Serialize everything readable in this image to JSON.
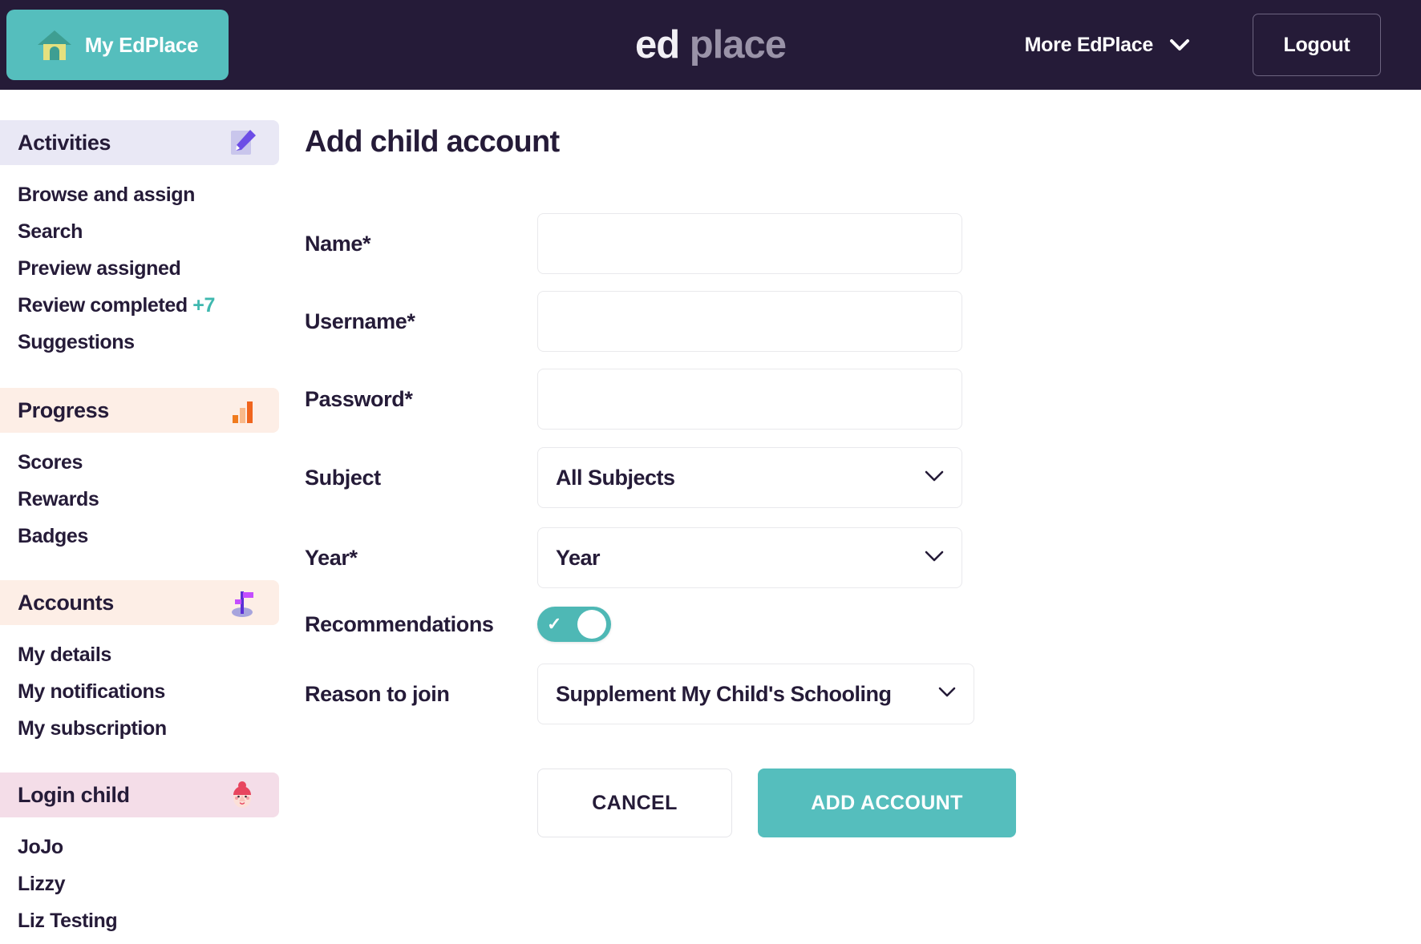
{
  "header": {
    "home_button_label": "My EdPlace",
    "home_icon": "house-icon",
    "logo_part1": "ed",
    "logo_part2": "place",
    "more_label": "More EdPlace",
    "more_chevron_icon": "chevron-down-icon",
    "logout_label": "Logout"
  },
  "sidebar": {
    "sections": [
      {
        "title": "Activities",
        "icon": "pencil-note-icon",
        "bg": "#e9e8f5",
        "items": [
          {
            "label": "Browse and assign",
            "badge": ""
          },
          {
            "label": "Search",
            "badge": ""
          },
          {
            "label": "Preview assigned",
            "badge": ""
          },
          {
            "label": "Review completed",
            "badge": "+7"
          },
          {
            "label": "Suggestions",
            "badge": ""
          }
        ]
      },
      {
        "title": "Progress",
        "icon": "bar-chart-icon",
        "bg": "#fdeee6",
        "items": [
          {
            "label": "Scores",
            "badge": ""
          },
          {
            "label": "Rewards",
            "badge": ""
          },
          {
            "label": "Badges",
            "badge": ""
          }
        ]
      },
      {
        "title": "Accounts",
        "icon": "signpost-icon",
        "bg": "#fdeee6",
        "items": [
          {
            "label": "My details",
            "badge": ""
          },
          {
            "label": "My notifications",
            "badge": ""
          },
          {
            "label": "My subscription",
            "badge": ""
          }
        ]
      },
      {
        "title": "Login child",
        "icon": "child-avatar-icon",
        "bg": "#f4dde8",
        "items": [
          {
            "label": "JoJo",
            "badge": ""
          },
          {
            "label": "Lizzy",
            "badge": ""
          },
          {
            "label": "Liz Testing",
            "badge": ""
          }
        ]
      }
    ]
  },
  "main": {
    "page_title": "Add child account",
    "fields": {
      "name": {
        "label": "Name*",
        "value": "",
        "placeholder": ""
      },
      "username": {
        "label": "Username*",
        "value": "",
        "placeholder": ""
      },
      "password": {
        "label": "Password*",
        "value": "",
        "placeholder": ""
      },
      "subject": {
        "label": "Subject",
        "value": "All Subjects",
        "chevron_icon": "chevron-down-icon"
      },
      "year": {
        "label": "Year*",
        "value": "Year",
        "chevron_icon": "chevron-down-icon"
      },
      "recommendations": {
        "label": "Recommendations",
        "state": "on",
        "check_glyph": "✓"
      },
      "reason": {
        "label": "Reason to join",
        "value": "Supplement My Child's Schooling",
        "chevron_icon": "chevron-down-icon"
      }
    },
    "buttons": {
      "cancel_label": "CANCEL",
      "submit_label": "ADD ACCOUNT"
    }
  },
  "colors": {
    "header_bg": "#251B38",
    "teal": "#55BEBD",
    "badge_teal": "#3FB8AF",
    "activities_bg": "#e9e8f5",
    "progress_bg": "#fdeee6",
    "login_bg": "#f4dde8"
  }
}
